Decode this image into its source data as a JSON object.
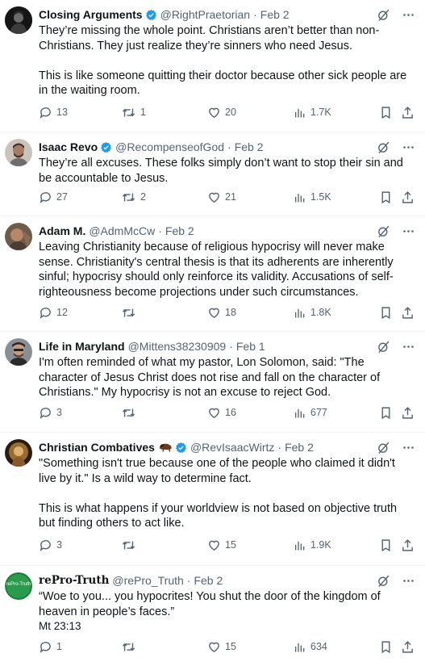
{
  "tweets": [
    {
      "name": "Closing Arguments",
      "handle": "@RightPraetorian",
      "dot": "·",
      "date": "Feb 2",
      "verified": true,
      "paragraphs": [
        "They’re missing the whole point. Christians aren’t better than non-Christians. They just realize they’re sinners who need Jesus.",
        "This is like someone quitting their doctor because other sick people are in the waiting room."
      ],
      "replies": "13",
      "retweets": "1",
      "likes": "20",
      "views": "1.7K"
    },
    {
      "name": "Isaac Revo",
      "handle": "@RecompenseofGod",
      "dot": "·",
      "date": "Feb 2",
      "verified": true,
      "paragraphs": [
        "They’re all excuses. These folks simply don’t want to stop their sin and be accountable to Jesus."
      ],
      "replies": "27",
      "retweets": "2",
      "likes": "21",
      "views": "1.5K"
    },
    {
      "name": "Adam M.",
      "handle": "@AdmMcCw",
      "dot": "·",
      "date": "Feb 2",
      "verified": false,
      "paragraphs": [
        "Leaving Christianity because of religious hypocrisy will never make sense. Christianity's central thesis is that its adherents are inherently sinful; hypocrisy should only reinforce its validity. Accusations of self-righteousness become projections under such circumstances."
      ],
      "replies": "12",
      "retweets": "",
      "likes": "18",
      "views": "1.8K"
    },
    {
      "name": "Life in Maryland",
      "handle": "@Mittens38230909",
      "dot": "·",
      "date": "Feb 1",
      "verified": false,
      "paragraphs": [
        "I'm often reminded of what my pastor, Lon Solomon, said: \"The character of Jesus Christ does not rise and fall on the character of Christians.\" My hypocrisy is not an excuse to reject God."
      ],
      "replies": "3",
      "retweets": "",
      "likes": "16",
      "views": "677"
    },
    {
      "name": "Christian Combatives",
      "handle": "@RevIsaacWirtz",
      "dot": "·",
      "date": "Feb 2",
      "verified": true,
      "paragraphs": [
        "\"Something isn't true because one of the people who claimed it didn't live by it.\" Is a wild way to determine fact.",
        "This is what happens if your worldview is not based on objective truth but finding others to act like."
      ],
      "replies": "3",
      "retweets": "",
      "likes": "15",
      "views": "1.9K"
    },
    {
      "name": "rePro-Truth",
      "handle": "@rePro_Truth",
      "dot": "·",
      "date": "Feb 2",
      "verified": false,
      "avatar_text": "rePro-Truth",
      "paragraphs": [
        "“Woe to you... you hypocrites! You shut the door of the kingdom of heaven in people’s faces.”",
        "Mt 23:13"
      ],
      "replies": "1",
      "retweets": "",
      "likes": "15",
      "views": "634"
    }
  ],
  "icons": {
    "reply": "reply-icon",
    "retweet": "retweet-icon",
    "like": "heart-icon",
    "views": "views-icon",
    "bookmark": "bookmark-icon",
    "share": "share-icon",
    "grok": "grok-icon",
    "more": "more-icon",
    "verified": "verified-badge-icon"
  },
  "colors": {
    "verified": "#1d9bf0",
    "muted": "#536471",
    "text": "#0f1419"
  }
}
